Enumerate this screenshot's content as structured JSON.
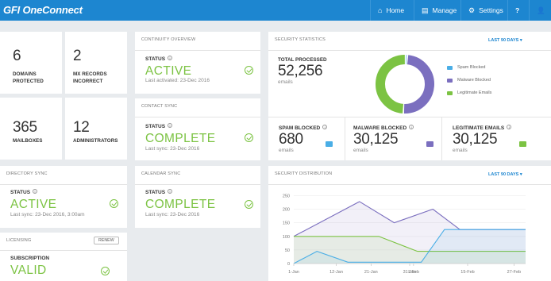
{
  "header": {
    "logo_brand": "GFI",
    "logo_product": "OneConnect",
    "nav": [
      {
        "label": "Home",
        "icon": "home-icon"
      },
      {
        "label": "Manage",
        "icon": "document-icon"
      },
      {
        "label": "Settings",
        "icon": "gear-icon"
      },
      {
        "label": "",
        "icon": "help-icon"
      },
      {
        "label": "",
        "icon": "user-icon"
      }
    ]
  },
  "tiles": {
    "domains": {
      "value": "6",
      "label": "DOMAINS PROTECTED"
    },
    "mx": {
      "value": "2",
      "label": "MX RECORDS INCORRECT"
    },
    "mailboxes": {
      "value": "365",
      "label": "MAILBOXES"
    },
    "admins": {
      "value": "12",
      "label": "ADMINISTRATORS"
    }
  },
  "continuity": {
    "title": "CONTINUITY OVERVIEW",
    "status_label": "STATUS",
    "status": "ACTIVE",
    "sub": "Last activated: 23-Dec 2016"
  },
  "contact_sync": {
    "title": "CONTACT SYNC",
    "status_label": "STATUS",
    "status": "COMPLETE",
    "sub": "Last sync: 23-Dec 2016"
  },
  "directory_sync": {
    "title": "DIRECTORY SYNC",
    "status_label": "STATUS",
    "status": "ACTIVE",
    "sub": "Last sync: 23-Dec 2016, 3:00am"
  },
  "calendar_sync": {
    "title": "CALENDAR SYNC",
    "status_label": "STATUS",
    "status": "COMPLETE",
    "sub": "Last sync: 23-Dec 2016"
  },
  "licensing": {
    "title": "LICENSING",
    "renew": "RENEW",
    "sub_label": "SUBSCRIPTION",
    "status": "VALID"
  },
  "security_stats": {
    "title": "SECURITY STATISTICS",
    "range": "LAST 90 DAYS",
    "total_label": "TOTAL PROCESSED",
    "total_value": "52,256",
    "total_unit": "emails",
    "legend": [
      {
        "label": "Spam Blocked",
        "color": "#4aaee6"
      },
      {
        "label": "Malware Blocked",
        "color": "#7b6fbf"
      },
      {
        "label": "Legitimate Emails",
        "color": "#7cc343"
      }
    ],
    "donut": [
      {
        "name": "Spam Blocked",
        "value": 680,
        "color": "#4aaee6"
      },
      {
        "name": "Malware Blocked",
        "value": 30125,
        "color": "#7b6fbf"
      },
      {
        "name": "Legitimate Emails",
        "value": 30125,
        "color": "#7cc343"
      }
    ],
    "cards": [
      {
        "label": "SPAM BLOCKED",
        "value": "680",
        "unit": "emails",
        "color": "#4aaee6"
      },
      {
        "label": "MALWARE BLOCKED",
        "value": "30,125",
        "unit": "emails",
        "color": "#7b6fbf"
      },
      {
        "label": "LEGITIMATE EMAILS",
        "value": "30,125",
        "unit": "emails",
        "color": "#7cc343"
      }
    ]
  },
  "security_distribution": {
    "title": "SECURITY DISTRIBUTION",
    "range": "LAST 90 DAYS"
  },
  "chart_data": {
    "type": "area",
    "x": [
      "1-Jan",
      "12-Jan",
      "21-Jan",
      "31-Jan",
      "1-Feb",
      "15-Feb",
      "27-Feb"
    ],
    "x_days": [
      0,
      11,
      20,
      30,
      31,
      45,
      57
    ],
    "yticks": [
      0,
      50,
      100,
      150,
      200,
      250
    ],
    "ylim": [
      0,
      260
    ],
    "xlim_days": [
      0,
      60
    ],
    "series": [
      {
        "color": "#7b6fbf",
        "points": [
          [
            0,
            100
          ],
          [
            17,
            228
          ],
          [
            26,
            150
          ],
          [
            36,
            200
          ],
          [
            43,
            125
          ],
          [
            60,
            125
          ]
        ]
      },
      {
        "color": "#7cc343",
        "points": [
          [
            0,
            100
          ],
          [
            22,
            100
          ],
          [
            32,
            45
          ],
          [
            60,
            45
          ]
        ]
      },
      {
        "color": "#4aaee6",
        "points": [
          [
            0,
            0
          ],
          [
            6,
            45
          ],
          [
            14,
            5
          ],
          [
            33,
            5
          ],
          [
            39,
            125
          ],
          [
            60,
            125
          ]
        ]
      }
    ]
  }
}
